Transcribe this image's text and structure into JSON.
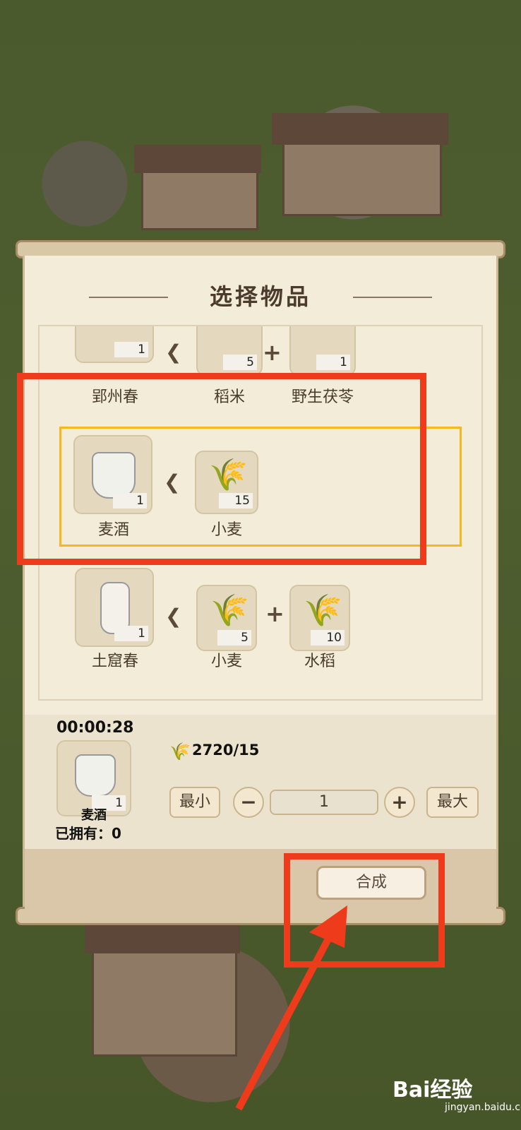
{
  "dialog": {
    "title": "选择物品"
  },
  "recipes": [
    {
      "product": {
        "name": "郢州春",
        "count": "1"
      },
      "ingredients": [
        {
          "name": "稻米",
          "count": "5"
        },
        {
          "name": "野生茯苓",
          "count": "1"
        }
      ]
    },
    {
      "product": {
        "name": "麦酒",
        "count": "1"
      },
      "ingredients": [
        {
          "name": "小麦",
          "count": "15"
        }
      ]
    },
    {
      "product": {
        "name": "土窟春",
        "count": "1"
      },
      "ingredients": [
        {
          "name": "小麦",
          "count": "5"
        },
        {
          "name": "水稻",
          "count": "10"
        }
      ]
    }
  ],
  "craft": {
    "timer": "00:00:28",
    "item_name": "麦酒",
    "item_count": "1",
    "owned_label": "已拥有：0",
    "resource": "2720/15",
    "min_label": "最小",
    "max_label": "最大",
    "minus_label": "−",
    "plus_label": "+",
    "quantity": "1",
    "synthesize_label": "合成"
  },
  "watermark": {
    "brand": "Bai经验",
    "site": "jingyan.baidu.com"
  },
  "colors": {
    "highlight_border": "#f5b91f",
    "annotation_red": "#ee3b1b",
    "panel_bg": "#f3ecd9"
  }
}
